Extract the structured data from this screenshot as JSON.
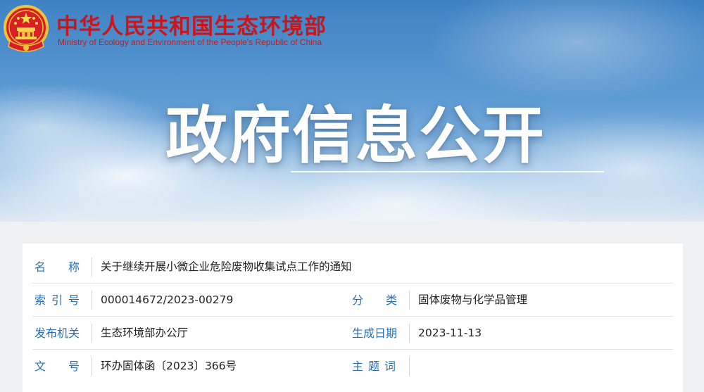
{
  "header": {
    "ministry_cn": "中华人民共和国生态环境部",
    "ministry_en": "Ministry of Ecology and Environment of the People's Republic of China",
    "hero_title": "政府信息公开"
  },
  "colors": {
    "brand_red": "#c8161d",
    "label_blue": "#2a6fb5",
    "sky_blue": "#3f82c4"
  },
  "info": {
    "name_label": [
      "名",
      "称"
    ],
    "name_value": "关于继续开展小微企业危险废物收集试点工作的通知",
    "index_label": [
      "索",
      "引",
      "号"
    ],
    "index_value": "000014672/2023-00279",
    "category_label": [
      "分",
      "类"
    ],
    "category_value": "固体废物与化学品管理",
    "issuer_label": "发布机关",
    "issuer_value": "生态环境部办公厅",
    "date_label": "生成日期",
    "date_value": "2023-11-13",
    "docno_label": [
      "文",
      "号"
    ],
    "docno_value": "环办固体函〔2023〕366号",
    "keywords_label": [
      "主",
      "题",
      "词"
    ],
    "keywords_value": ""
  }
}
